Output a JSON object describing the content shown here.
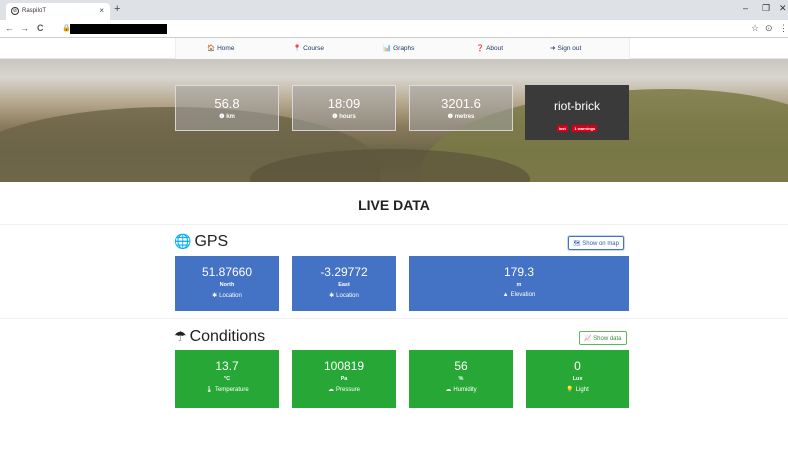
{
  "browser": {
    "tab_title": "RaspiIoT",
    "tab_close": "×",
    "new_tab": "+",
    "back": "←",
    "forward": "→",
    "reload": "C",
    "lock": "🔒",
    "star": "☆",
    "account": "⊙",
    "menu": "⋮",
    "minimize": "–",
    "restore": "❐",
    "close": "✕"
  },
  "nav": {
    "items": [
      {
        "label": "Home",
        "icon": "home-icon",
        "glyph": "🏠"
      },
      {
        "label": "Course",
        "icon": "map-marker-icon",
        "glyph": "📍"
      },
      {
        "label": "Graphs",
        "icon": "bar-chart-icon",
        "glyph": "📊"
      },
      {
        "label": "About",
        "icon": "question-circle-icon",
        "glyph": "❓"
      },
      {
        "label": "Sign out",
        "icon": "sign-out-icon",
        "glyph": "➜"
      }
    ]
  },
  "hero": {
    "stats": [
      {
        "value": "56.8",
        "unit": "km",
        "glyph": "❶"
      },
      {
        "value": "18:09",
        "unit": "hours",
        "glyph": "❶"
      },
      {
        "value": "3201.6",
        "unit": "metres",
        "glyph": "❶"
      }
    ],
    "device": {
      "name": "riot-brick",
      "badges": [
        "lost",
        "1 warnings"
      ]
    }
  },
  "live": {
    "title": "LIVE DATA",
    "gps": {
      "heading": "GPS",
      "glyph": "🌐",
      "button": "Show on map",
      "button_glyph": "🗺",
      "cards": [
        {
          "value": "51.87660",
          "unit": "North",
          "label": "Location",
          "glyph": "✱"
        },
        {
          "value": "-3.29772",
          "unit": "East",
          "label": "Location",
          "glyph": "✱"
        },
        {
          "value": "179.3",
          "unit": "m",
          "label": "Elevation",
          "glyph": "▲"
        }
      ]
    },
    "conditions": {
      "heading": "Conditions",
      "glyph": "☂",
      "button": "Show data",
      "button_glyph": "📈",
      "cards": [
        {
          "value": "13.7",
          "unit": "°C",
          "label": "Temperature",
          "glyph": "🌡"
        },
        {
          "value": "100819",
          "unit": "Pa",
          "label": "Pressure",
          "glyph": "☁"
        },
        {
          "value": "56",
          "unit": "%",
          "label": "Humidity",
          "glyph": "☁"
        },
        {
          "value": "0",
          "unit": "Lux",
          "label": "Light",
          "glyph": "💡"
        }
      ]
    }
  },
  "colors": {
    "primary": "#4472c4",
    "success": "#27a836",
    "danger": "#d0021b",
    "dark": "#3a3a3a"
  }
}
